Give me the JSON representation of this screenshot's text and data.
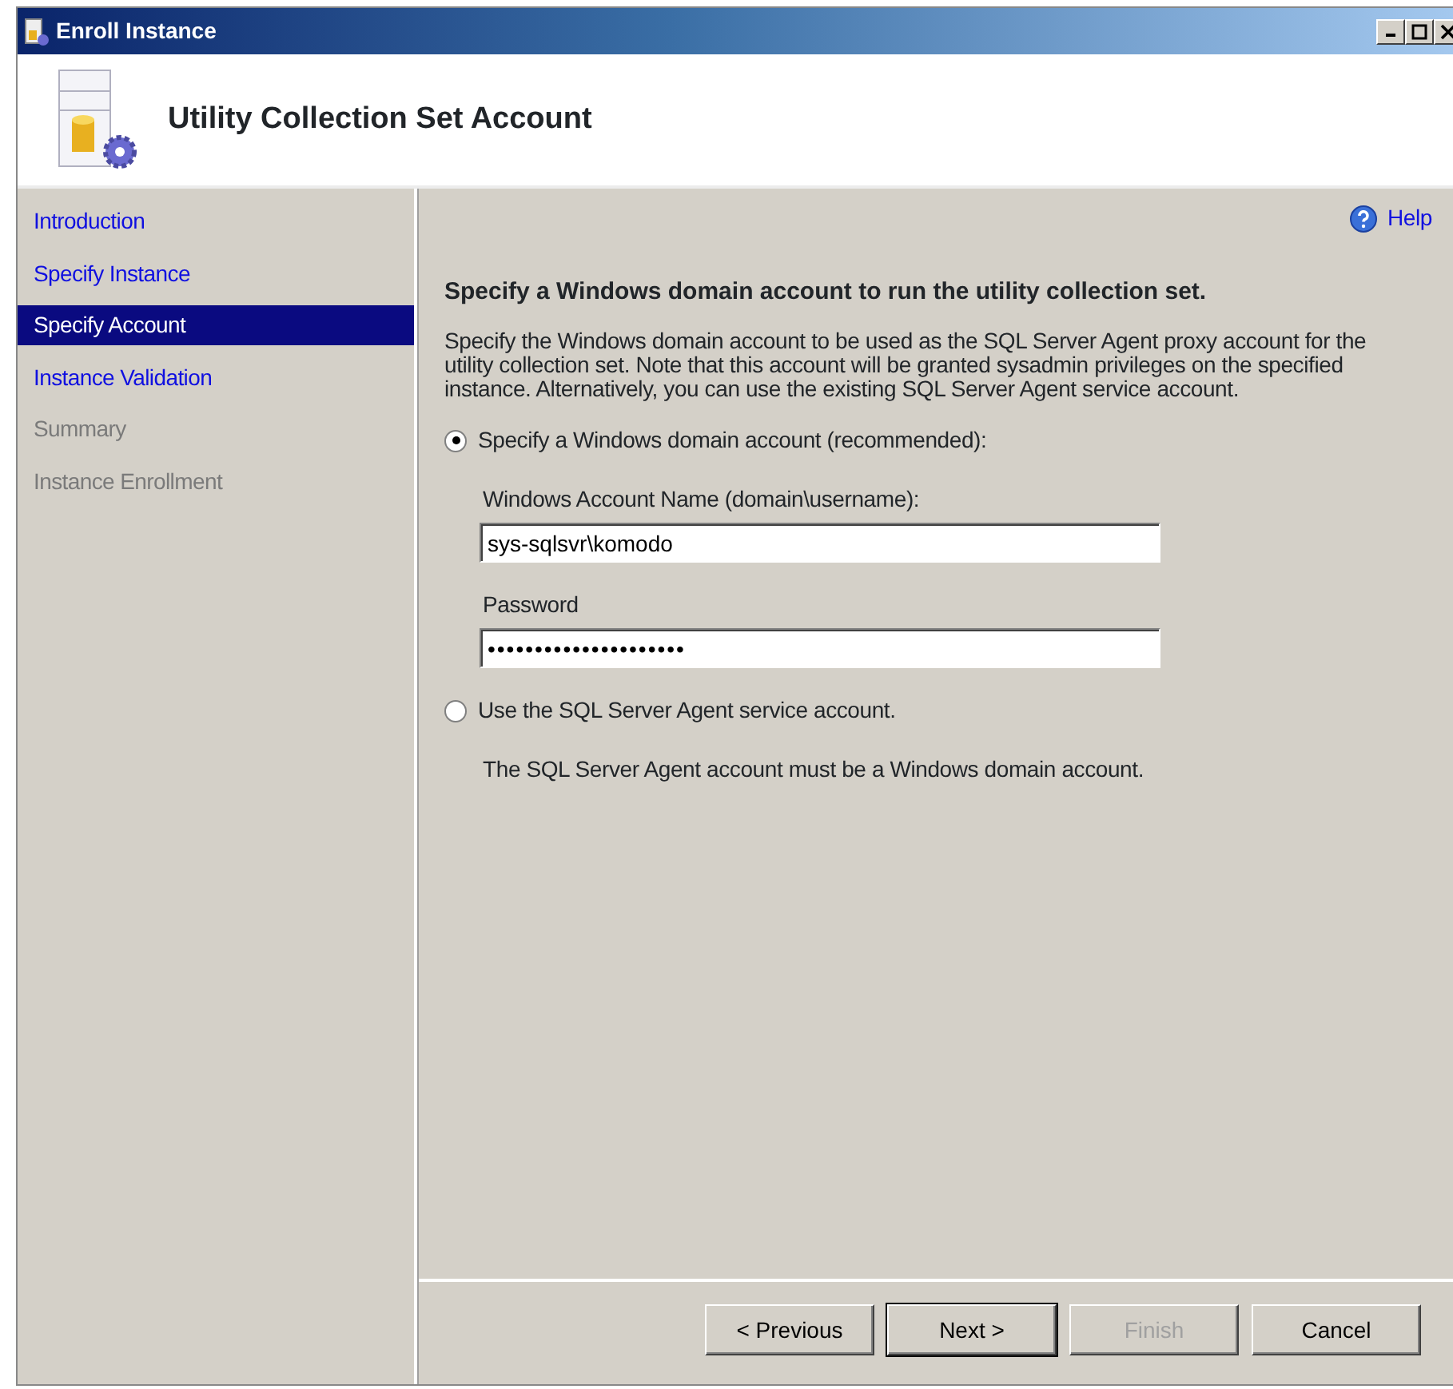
{
  "window": {
    "title": "Enroll Instance"
  },
  "header": {
    "title": "Utility Collection Set Account"
  },
  "sidebar": {
    "items": [
      {
        "label": "Introduction",
        "selected": false,
        "disabled": false
      },
      {
        "label": "Specify Instance",
        "selected": false,
        "disabled": false
      },
      {
        "label": "Specify Account",
        "selected": true,
        "disabled": false
      },
      {
        "label": "Instance Validation",
        "selected": false,
        "disabled": false
      },
      {
        "label": "Summary",
        "selected": false,
        "disabled": true
      },
      {
        "label": "Instance Enrollment",
        "selected": false,
        "disabled": true
      }
    ]
  },
  "help": {
    "label": "Help"
  },
  "content": {
    "heading": "Specify a Windows domain account to run the utility collection set.",
    "description": "Specify the Windows domain account to be used as the SQL Server Agent proxy account for the utility collection set. Note that this account will be granted sysadmin privileges on the specified instance. Alternatively, you can use the existing SQL Server Agent service account.",
    "options": [
      {
        "label": "Specify a Windows domain account (recommended):",
        "selected": true,
        "fields": [
          {
            "label": "Windows Account Name (domain\\username):",
            "value": "sys-sqlsvr\\komodo"
          },
          {
            "label": "Password",
            "value": "•••••••••••••••••••••"
          }
        ]
      },
      {
        "label": "Use the SQL Server Agent service account.",
        "selected": false,
        "note": "The SQL Server Agent account must be a Windows domain account."
      }
    ]
  },
  "buttons": [
    {
      "label": "< Previous",
      "disabled": false,
      "default": false
    },
    {
      "label": "Next >",
      "disabled": false,
      "default": true
    },
    {
      "label": "Finish",
      "disabled": true,
      "default": false
    },
    {
      "label": "Cancel",
      "disabled": false,
      "default": false
    }
  ]
}
